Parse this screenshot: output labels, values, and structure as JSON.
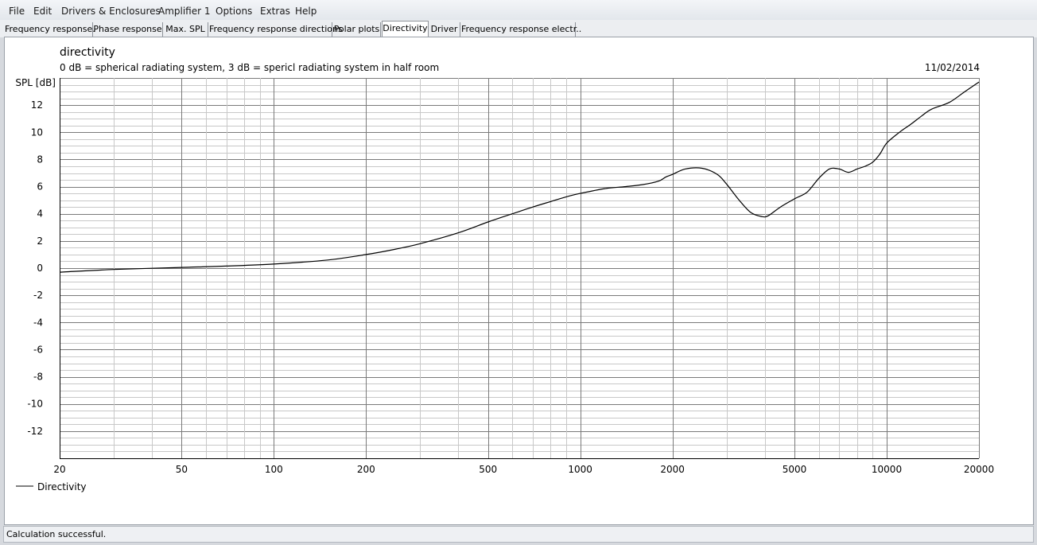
{
  "menu": [
    "File",
    "Edit",
    "Drivers & Enclosures",
    "Amplifier 1",
    "Options",
    "Extras",
    "Help"
  ],
  "tabs": [
    {
      "label": "Frequency response.",
      "active": false
    },
    {
      "label": "Phase response",
      "active": false
    },
    {
      "label": "Max. SPL",
      "active": false
    },
    {
      "label": "Frequency response directions",
      "active": false
    },
    {
      "label": "Polar plots",
      "active": false
    },
    {
      "label": "Directivity",
      "active": true
    },
    {
      "label": "Driver",
      "active": false
    },
    {
      "label": "Frequency response electr..",
      "active": false
    }
  ],
  "plot": {
    "title": "directivity",
    "subtitle": "0 dB = spherical radiating system, 3 dB = spericl radiating system in half room",
    "date": "11/02/2014",
    "legend_label": "Directivity"
  },
  "status": "Calculation successful.",
  "chart_data": {
    "type": "line",
    "title": "directivity",
    "subtitle": "0 dB = spherical radiating system, 3 dB = spericl radiating system in half room",
    "ylabel": "SPL [dB]",
    "xlabel": "",
    "x_scale": "log",
    "xlim": [
      20,
      20000
    ],
    "ylim": [
      -14,
      14
    ],
    "x_ticks": [
      "20",
      "50",
      "100",
      "200",
      "500",
      "1000",
      "2000",
      "5000",
      "10000",
      "20000"
    ],
    "y_ticks": [
      "12",
      "10",
      "8",
      "6",
      "4",
      "2",
      "0",
      "-2",
      "-4",
      "-6",
      "-8",
      "-10",
      "-12"
    ],
    "grid": true,
    "legend": "bottom-left",
    "series": [
      {
        "name": "Directivity",
        "color": "#000000",
        "x": [
          20,
          30,
          50,
          70,
          100,
          150,
          200,
          250,
          300,
          400,
          500,
          600,
          700,
          800,
          900,
          1000,
          1200,
          1400,
          1600,
          1800,
          1900,
          2000,
          2200,
          2500,
          2800,
          3000,
          3300,
          3600,
          3900,
          4100,
          4500,
          5000,
          5500,
          6000,
          6500,
          7000,
          7500,
          8000,
          8500,
          9000,
          9500,
          10000,
          11000,
          12000,
          13000,
          14000,
          16000,
          18000,
          20000
        ],
        "y": [
          -0.3,
          -0.1,
          0.05,
          0.15,
          0.3,
          0.6,
          1.0,
          1.4,
          1.8,
          2.6,
          3.4,
          4.0,
          4.5,
          4.9,
          5.25,
          5.5,
          5.85,
          6.0,
          6.15,
          6.4,
          6.7,
          6.9,
          7.3,
          7.35,
          6.9,
          6.2,
          5.0,
          4.1,
          3.8,
          3.85,
          4.5,
          5.1,
          5.6,
          6.6,
          7.3,
          7.3,
          7.05,
          7.3,
          7.5,
          7.8,
          8.4,
          9.2,
          10.0,
          10.6,
          11.2,
          11.7,
          12.2,
          13.0,
          13.7
        ]
      }
    ]
  }
}
